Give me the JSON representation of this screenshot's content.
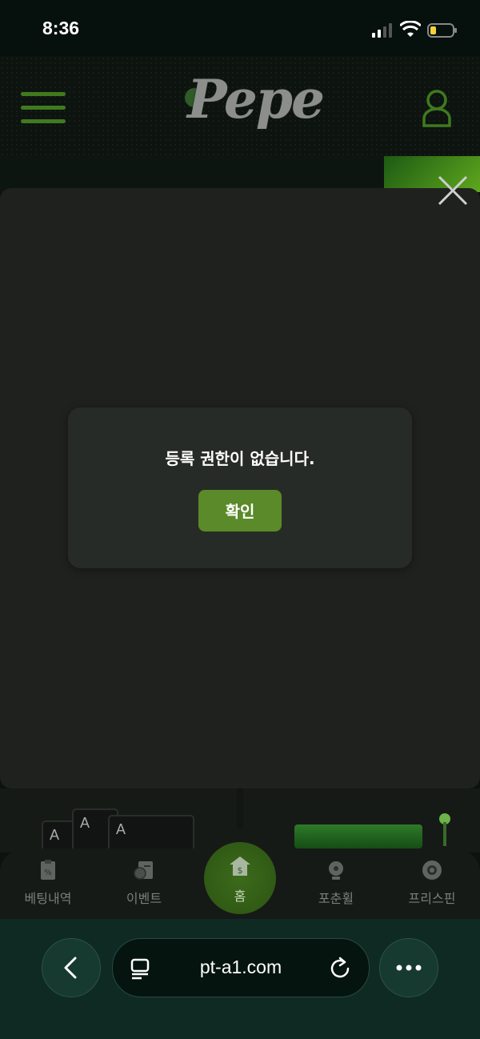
{
  "status_bar": {
    "time": "8:36"
  },
  "header": {
    "logo_text": "Pepe"
  },
  "dialog": {
    "message": "등록 권한이 없습니다.",
    "confirm_label": "확인"
  },
  "bottom_nav": {
    "items": [
      {
        "label": "베팅내역",
        "icon": "betting-history-icon"
      },
      {
        "label": "이벤트",
        "icon": "event-icon"
      },
      {
        "label": "홈",
        "icon": "home-icon"
      },
      {
        "label": "포춘휠",
        "icon": "fortune-wheel-icon"
      },
      {
        "label": "프리스핀",
        "icon": "free-spin-icon"
      }
    ]
  },
  "game_cards": {
    "card_letters": [
      "A",
      "A",
      "A"
    ]
  },
  "browser": {
    "url": "pt-a1.com"
  },
  "colors": {
    "accent": "#5a8a29",
    "background": "#1f211f",
    "dialog": "#272b27"
  }
}
